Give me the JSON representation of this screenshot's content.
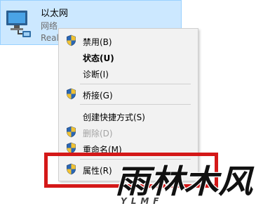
{
  "adapter": {
    "name": "以太网",
    "type": "网络",
    "device": "Real",
    "icon": "network-adapter-icon"
  },
  "menu": {
    "items": [
      {
        "label": "禁用(B)",
        "shield": true
      },
      {
        "label": "状态(U)",
        "bold": true
      },
      {
        "label": "诊断(I)"
      },
      {
        "label": "桥接(G)",
        "shield": true
      },
      {
        "label": "创建快捷方式(S)"
      },
      {
        "label": "删除(D)",
        "shield": true,
        "disabled": true
      },
      {
        "label": "重命名(M)",
        "shield": true
      },
      {
        "label": "属性(R)",
        "shield": true
      }
    ]
  },
  "watermark": {
    "text": "雨林木风",
    "latin": "YLMF"
  },
  "colors": {
    "selection_bg": "#cce8ff",
    "menu_bg": "#f2f2f2",
    "highlight_border": "#d41818"
  }
}
